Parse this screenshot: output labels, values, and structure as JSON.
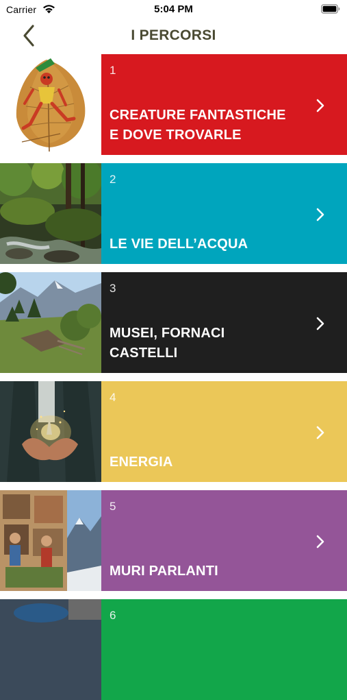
{
  "status_bar": {
    "carrier": "Carrier",
    "time": "5:04 PM",
    "icons": [
      "wifi-icon",
      "battery-icon"
    ]
  },
  "nav": {
    "title": "I PERCORSI",
    "back_icon": "chevron-left-icon",
    "title_color": "#4a4a32"
  },
  "routes": [
    {
      "number": "1",
      "title": "CREATURE FANTASTICHE\nE DOVE TROVARLE",
      "color": "#d7191f",
      "thumbnail": "leaf-creature-illustration"
    },
    {
      "number": "2",
      "title": "LE VIE DELL’ACQUA",
      "color": "#00a5bd",
      "thumbnail": "forest-stream-photo"
    },
    {
      "number": "3",
      "title": "MUSEI, FORNACI\nCASTELLI",
      "color": "#1f1f1f",
      "thumbnail": "mountain-valley-photo"
    },
    {
      "number": "4",
      "title": "ENERGIA",
      "color": "#ebc758",
      "thumbnail": "hands-with-light-photo"
    },
    {
      "number": "5",
      "title": "MURI PARLANTI",
      "color": "#945598",
      "thumbnail": "painted-wall-photo"
    },
    {
      "number": "6",
      "title": "",
      "color": "#12a64a",
      "thumbnail": "partial-photo"
    }
  ]
}
